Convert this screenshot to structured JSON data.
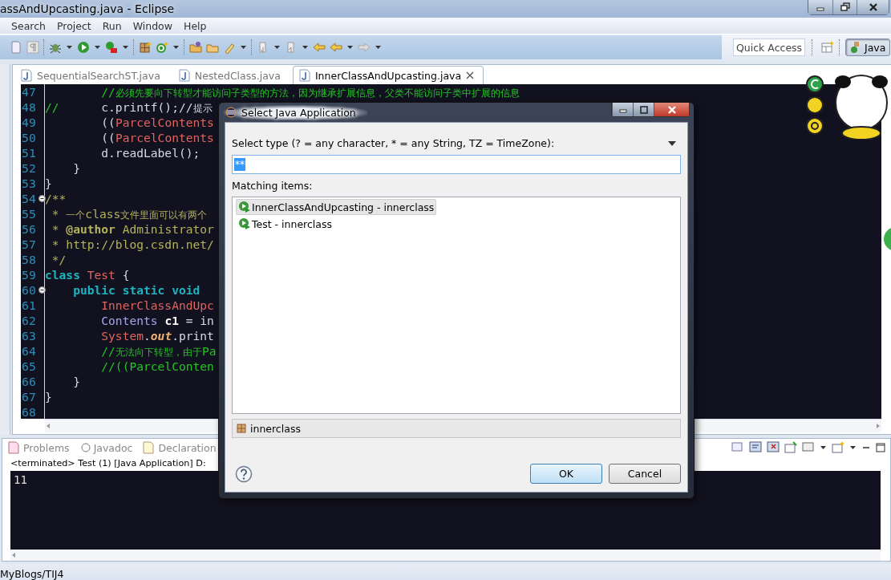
{
  "window": {
    "title": "assAndUpcasting.java - Eclipse"
  },
  "menu": [
    {
      "label": "Search"
    },
    {
      "label": "Project"
    },
    {
      "label": "Run"
    },
    {
      "label": "Window"
    },
    {
      "label": "Help"
    }
  ],
  "toolbar": {
    "quick_access": {
      "placeholder": "Quick Access"
    },
    "perspective": {
      "label": "Java",
      "selected": true
    }
  },
  "editor": {
    "tabs": [
      {
        "label": "SequentialSearchST.java",
        "selected": false
      },
      {
        "label": "NestedClass.java",
        "selected": false
      },
      {
        "label": "InnerClassAndUpcasting.java",
        "selected": true
      }
    ],
    "lines": [
      {
        "number": "47",
        "fold": false,
        "tokens": [
          {
            "kind": "comment",
            "text": "        //必须先要向下转型才能访问子类型的方法，因为继承扩展信息，父类不能访问子类中扩展的信息"
          }
        ]
      },
      {
        "number": "48",
        "fold": false,
        "tokens": [
          {
            "kind": "comment",
            "text": "//"
          },
          {
            "kind": "plain",
            "text": "      c.printf();//提示"
          }
        ]
      },
      {
        "number": "49",
        "fold": false,
        "tokens": [
          {
            "kind": "plain",
            "text": "        (("
          },
          {
            "kind": "type",
            "text": "ParcelContents"
          }
        ]
      },
      {
        "number": "50",
        "fold": false,
        "tokens": [
          {
            "kind": "plain",
            "text": "        (("
          },
          {
            "kind": "type",
            "text": "ParcelContents"
          }
        ]
      },
      {
        "number": "51",
        "fold": false,
        "tokens": [
          {
            "kind": "plain",
            "text": "        d.readLabel();"
          }
        ]
      },
      {
        "number": "52",
        "fold": false,
        "tokens": [
          {
            "kind": "plain",
            "text": "    }"
          }
        ]
      },
      {
        "number": "53",
        "fold": false,
        "tokens": [
          {
            "kind": "plain",
            "text": "}"
          }
        ]
      },
      {
        "number": "54",
        "fold": true,
        "tokens": [
          {
            "kind": "doc",
            "text": "/**"
          }
        ]
      },
      {
        "number": "55",
        "fold": false,
        "tokens": [
          {
            "kind": "doc",
            "text": " * 一个class文件里面可以有两个"
          }
        ]
      },
      {
        "number": "56",
        "fold": false,
        "tokens": [
          {
            "kind": "doc",
            "text": " * "
          },
          {
            "kind": "doctag",
            "text": "@author"
          },
          {
            "kind": "doc",
            "text": " Administrator"
          }
        ]
      },
      {
        "number": "57",
        "fold": false,
        "tokens": [
          {
            "kind": "doc",
            "text": " * http://blog.csdn.net/"
          }
        ]
      },
      {
        "number": "58",
        "fold": false,
        "tokens": [
          {
            "kind": "doc",
            "text": " */"
          }
        ]
      },
      {
        "number": "59",
        "fold": false,
        "tokens": [
          {
            "kind": "keyword",
            "text": "class"
          },
          {
            "kind": "type",
            "text": " Test"
          },
          {
            "kind": "plain",
            "text": " {"
          }
        ]
      },
      {
        "number": "60",
        "fold": true,
        "tokens": [
          {
            "kind": "keyword",
            "text": "    public static void"
          }
        ]
      },
      {
        "number": "61",
        "fold": false,
        "tokens": [
          {
            "kind": "type",
            "text": "        InnerClassAndUpc"
          }
        ]
      },
      {
        "number": "62",
        "fold": false,
        "tokens": [
          {
            "kind": "iface",
            "text": "        Contents"
          },
          {
            "kind": "local",
            "text": " c1"
          },
          {
            "kind": "plain",
            "text": " = in"
          }
        ]
      },
      {
        "number": "63",
        "fold": false,
        "tokens": [
          {
            "kind": "type",
            "text": "        System"
          },
          {
            "kind": "plain",
            "text": "."
          },
          {
            "kind": "field",
            "text": "out"
          },
          {
            "kind": "plain",
            "text": ".print"
          }
        ]
      },
      {
        "number": "64",
        "fold": false,
        "tokens": [
          {
            "kind": "comment",
            "text": "        //无法向下转型，由于Pa"
          }
        ]
      },
      {
        "number": "65",
        "fold": false,
        "tokens": [
          {
            "kind": "comment",
            "text": "        //((ParcelConten"
          }
        ]
      },
      {
        "number": "66",
        "fold": false,
        "tokens": [
          {
            "kind": "plain",
            "text": "    }"
          }
        ]
      },
      {
        "number": "67",
        "fold": false,
        "tokens": [
          {
            "kind": "plain",
            "text": "}"
          }
        ]
      },
      {
        "number": "68",
        "fold": false
      }
    ]
  },
  "bottom_panel": {
    "tabs": [
      {
        "label": "Problems",
        "selected": false
      },
      {
        "label": "Javadoc",
        "selected": false
      },
      {
        "label": "Declaration",
        "selected": false
      }
    ],
    "console_header": "<terminated> Test (1) [Java Application] D:",
    "console_output": "11"
  },
  "status_bar": {
    "text": "MyBlogs/TIJ4"
  },
  "dialog": {
    "title": "Select Java Application",
    "prompt": "Select type (? = any character, * = any String, TZ = TimeZone):",
    "search": {
      "value": "**"
    },
    "list_label": "Matching items:",
    "items": [
      {
        "label": "InnerClassAndUpcasting - innerclass",
        "selected": true
      },
      {
        "label": "Test - innerclass",
        "selected": false
      }
    ],
    "package": "innerclass",
    "buttons": [
      {
        "label": "OK",
        "default": true
      },
      {
        "label": "Cancel",
        "default": false
      }
    ]
  }
}
